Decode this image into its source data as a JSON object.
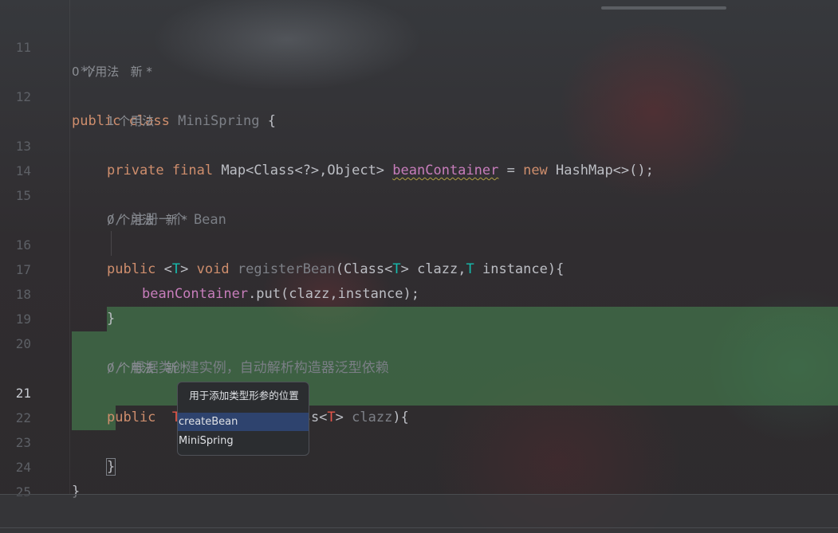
{
  "editor": {
    "lines": [
      {
        "num": "11",
        "code": " */"
      },
      {
        "num": "12",
        "kw1": "public",
        "kw2": "class",
        "cls": "MiniSpring",
        "rest": " {"
      },
      {
        "num": "13",
        "kw1": "private",
        "kw2": "final",
        "type": "Map<Class<?>,Object>",
        "field": "beanContainer",
        "eq": " = ",
        "kw3": "new",
        "rest": " HashMap<>();"
      },
      {
        "num": "14"
      },
      {
        "num": "15",
        "comment": "// 注册一个 Bean"
      },
      {
        "num": "16",
        "kw1": "public",
        "tparam_open": "<",
        "tparam": "T",
        "tparam_close": ">",
        "kw2": "void",
        "method": "registerBean",
        "p1": "(Class<",
        "t1": "T",
        "p2": "> clazz,",
        "t2": "T",
        "p3": " instance){"
      },
      {
        "num": "17",
        "field": "beanContainer",
        "rest": ".put(clazz,instance);"
      },
      {
        "num": "18",
        "code": "}"
      },
      {
        "num": "19"
      },
      {
        "num": "20",
        "comment": "// 根据类创建实例，自动解析构造器泛型依赖"
      },
      {
        "num": "21",
        "kw1": "public",
        "tparam": "T",
        "method": "createBean",
        "p1": "(Class<",
        "t1": "T",
        "p2": "> ",
        "param": "clazz",
        "p3": "){"
      },
      {
        "num": "22"
      },
      {
        "num": "23",
        "code": "}"
      },
      {
        "num": "24",
        "code": "}"
      },
      {
        "num": "25"
      }
    ],
    "hints": {
      "h12": "0 个用法   新 *",
      "h13": "1 个用法",
      "h16": "0 个用法   新 *",
      "h21": "0 个用法   新 *"
    }
  },
  "popup": {
    "title": "用于添加类型形参的位置",
    "items": [
      "createBean",
      "MiniSpring"
    ],
    "selected": "createBean"
  },
  "colors": {
    "keyword": "#cf8e6d",
    "field": "#c77dbb",
    "type_param": "#16baac",
    "type_param_error": "#e5564a",
    "comment": "#7a7e85",
    "selection": "#488c54"
  }
}
